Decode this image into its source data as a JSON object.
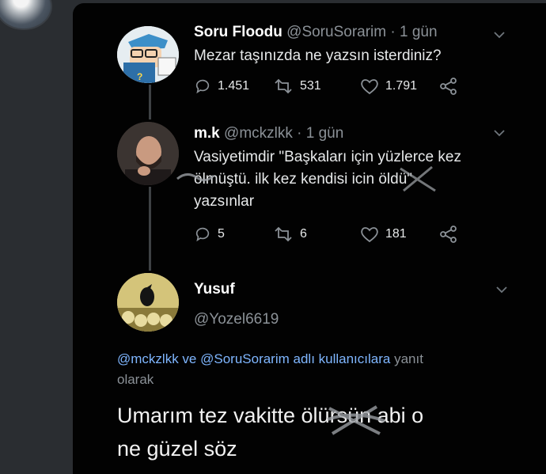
{
  "tweets": [
    {
      "name": "Soru Floodu",
      "handle": "@SoruSorarim",
      "time": " · 1 gün",
      "text": "Mezar taşınızda ne yazsın isterdiniz?",
      "replies": "1.451",
      "retweets": "531",
      "likes": "1.791"
    },
    {
      "name": "m.k",
      "handle": "@mckzlkk",
      "time": " · 1 gün",
      "text_line1": "Vasiyetimdir \"Başkaları için yüzlerce kez",
      "text_line2": "ölmüştü. ilk kez kendisi icin öldü\"",
      "text_line3": "yazsınlar",
      "replies": "5",
      "retweets": "6",
      "likes": "181"
    }
  ],
  "focus": {
    "name": "Yusuf",
    "handle": "@Yozel6619",
    "reply_link1": "@mckzlkk",
    "reply_mid": " ve ",
    "reply_link2": "@SoruSorarim adlı kullanıcılara",
    "reply_tail1": " yanıt",
    "reply_tail2": "olarak",
    "text_line1": "Umarım tez vakitte ölürsün abi o",
    "text_line2": "ne güzel söz"
  },
  "icons": [
    "reply-icon",
    "retweet-icon",
    "like-icon",
    "share-icon",
    "chevron-down-icon"
  ],
  "colors": {
    "background": "#020202",
    "page": "#2a2d31",
    "link": "#7fb6ff",
    "muted": "#8b9197"
  }
}
